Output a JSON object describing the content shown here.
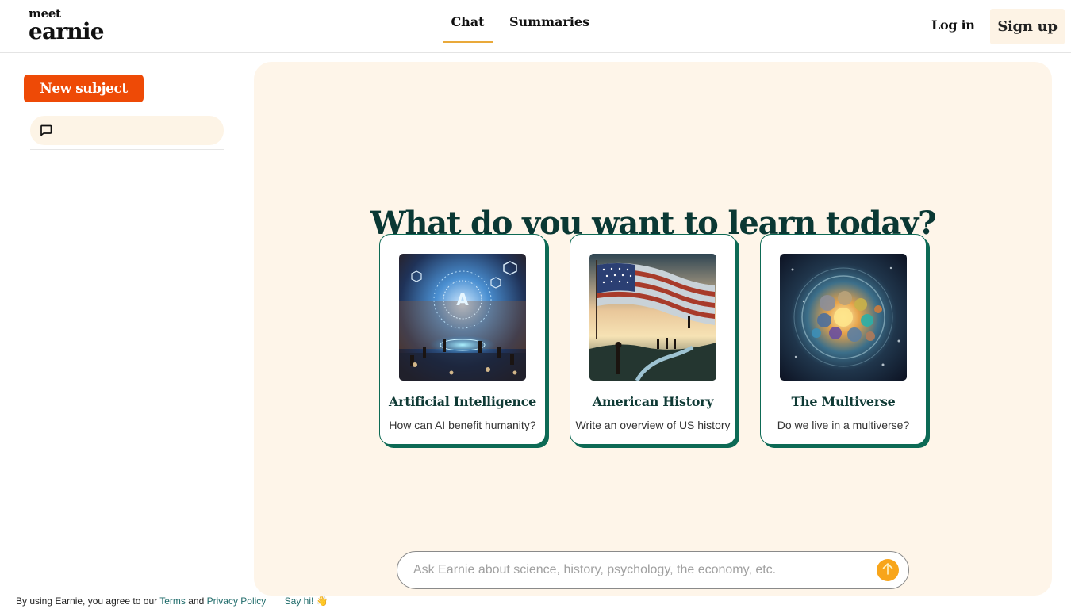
{
  "header": {
    "logo_top": "meet",
    "logo_bottom": "earnie",
    "tabs": [
      {
        "label": "Chat",
        "active": true
      },
      {
        "label": "Summaries",
        "active": false
      }
    ],
    "login_label": "Log in",
    "signup_label": "Sign up"
  },
  "sidebar": {
    "new_subject_label": "New subject",
    "chat_items": [
      {
        "icon": "message-square-icon",
        "label": ""
      }
    ]
  },
  "main": {
    "headline": "What do you want to learn today?",
    "cards": [
      {
        "title": "Artificial Intelligence",
        "description": "How can AI benefit humanity?",
        "image": "ai-network-illustration"
      },
      {
        "title": "American History",
        "description": "Write an overview of US history",
        "image": "american-flag-illustration"
      },
      {
        "title": "The Multiverse",
        "description": "Do we live in a multiverse?",
        "image": "multiverse-bubbles-illustration"
      }
    ],
    "ask_input": {
      "value": "",
      "placeholder": "Ask Earnie about science, history, psychology, the economy, etc."
    },
    "send_icon": "arrow-up-icon"
  },
  "footer": {
    "prefix": "By using Earnie, you agree to our ",
    "terms_label": "Terms",
    "and": " and ",
    "privacy_label": "Privacy Policy",
    "say_hi_label": "Say hi!",
    "say_hi_emoji": "👋"
  },
  "colors": {
    "accent_orange": "#ee4a06",
    "tab_underline": "#e9a93a",
    "card_border": "#0d6a55",
    "headline": "#0a3834",
    "panel_bg": "#fef5e9",
    "send_button": "#f8a51a",
    "link": "#1f6b6a"
  }
}
